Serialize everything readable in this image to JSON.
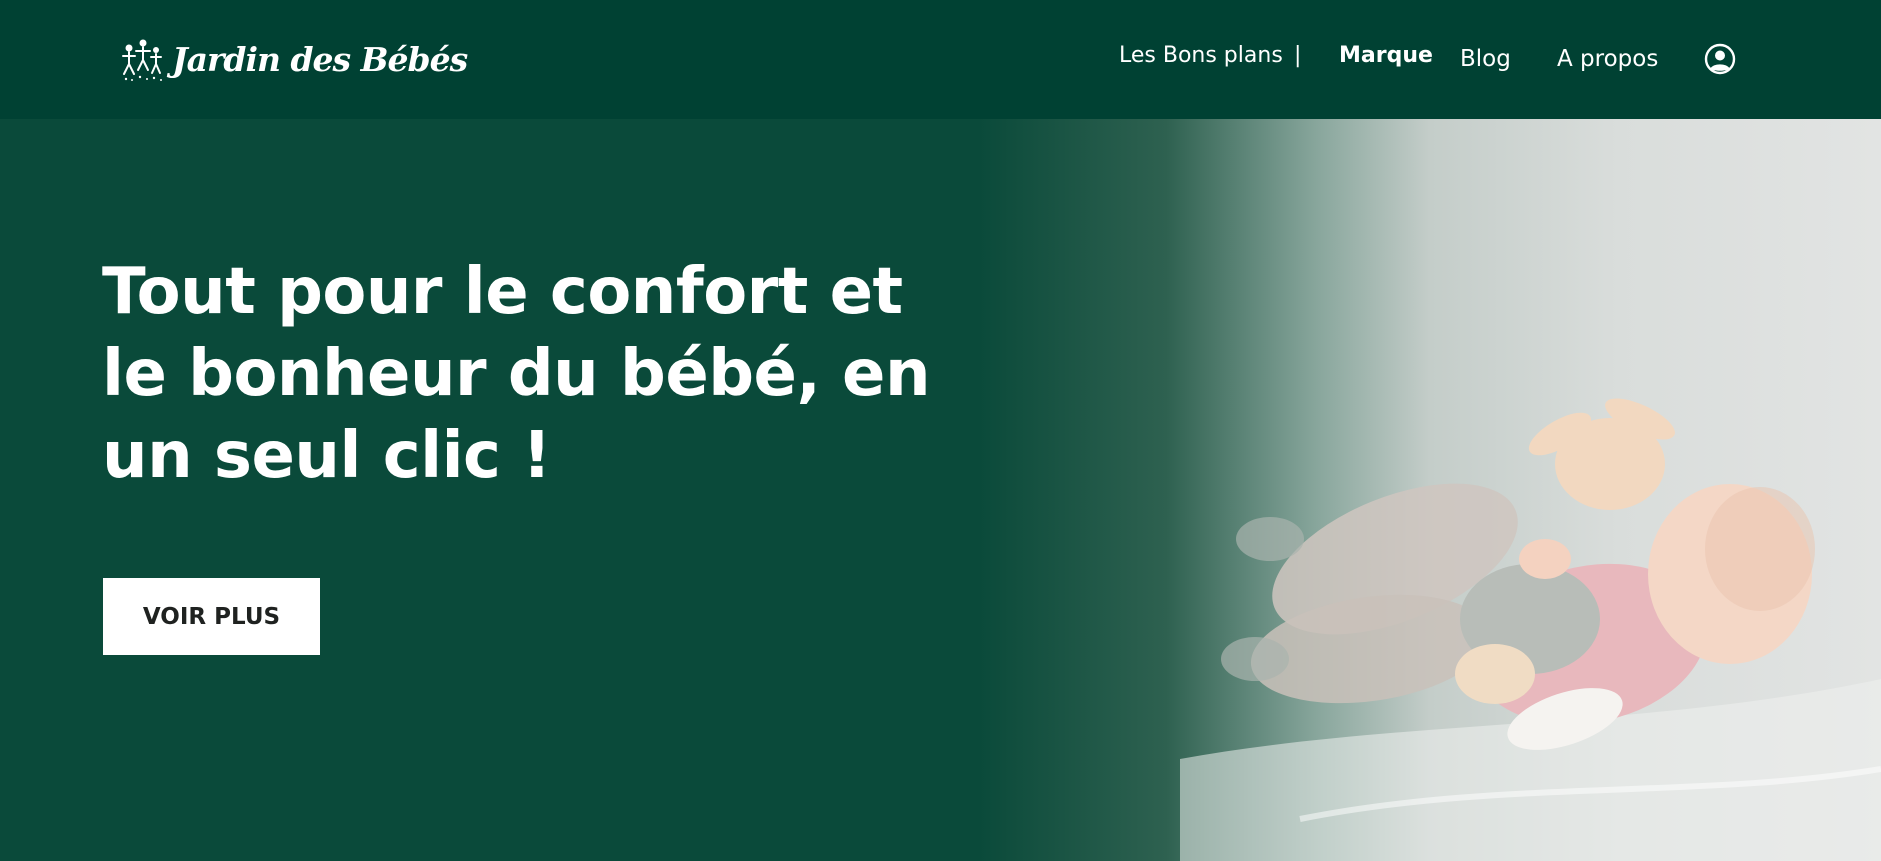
{
  "header": {
    "logo_text": "Jardin des Bébés",
    "logo_icon": "family-icon",
    "nav": {
      "bons_plans": "Les Bons plans",
      "separator": "|",
      "marque": "Marque",
      "blog": "Blog",
      "a_propos": "A propos"
    },
    "account_icon": "user-circle-icon"
  },
  "hero": {
    "title": "Tout pour le confort et le bonheur du bébé, en un seul clic !",
    "cta_label": "VOIR PLUS",
    "image": "baby-with-plush-bunny"
  },
  "colors": {
    "header_bg": "#004133",
    "hero_bg": "#0a4a3a",
    "text_light": "#ffffff",
    "button_bg": "#ffffff",
    "button_text": "#1f2220"
  }
}
